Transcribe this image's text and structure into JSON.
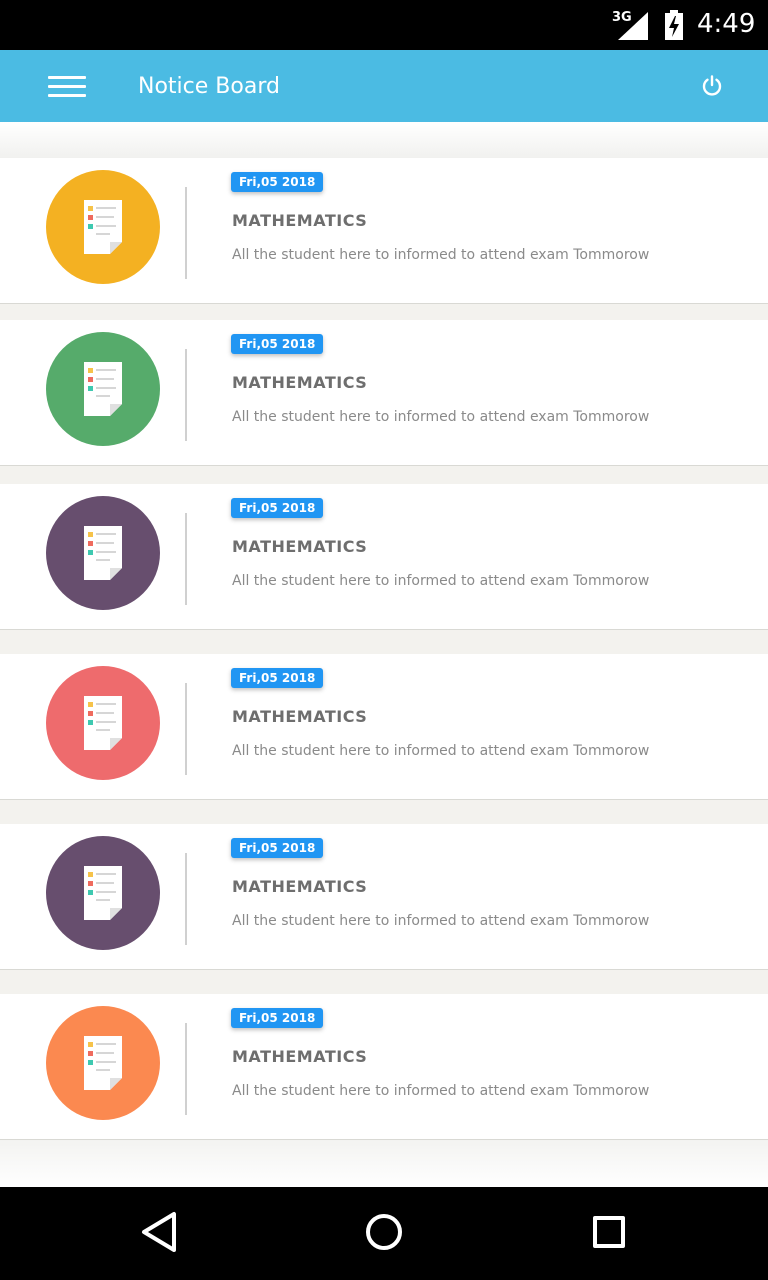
{
  "status_bar": {
    "network": "3G",
    "time": "4:49"
  },
  "app_bar": {
    "title": "Notice Board"
  },
  "notices": [
    {
      "date": "Fri,05 2018",
      "subject": "MATHEMATICS",
      "message": "All the student here to informed to attend exam Tommorow",
      "color": "#f4b122"
    },
    {
      "date": "Fri,05 2018",
      "subject": "MATHEMATICS",
      "message": "All the student here to informed to attend exam Tommorow",
      "color": "#56ab6b"
    },
    {
      "date": "Fri,05 2018",
      "subject": "MATHEMATICS",
      "message": "All the student here to informed to attend exam Tommorow",
      "color": "#674e6e"
    },
    {
      "date": "Fri,05 2018",
      "subject": "MATHEMATICS",
      "message": "All the student here to informed to attend exam Tommorow",
      "color": "#ee6b6d"
    },
    {
      "date": "Fri,05 2018",
      "subject": "MATHEMATICS",
      "message": "All the student here to informed to attend exam Tommorow",
      "color": "#674e6e"
    },
    {
      "date": "Fri,05 2018",
      "subject": "MATHEMATICS",
      "message": "All the student here to informed to attend exam Tommorow",
      "color": "#fb8950"
    }
  ],
  "colors": {
    "app_bar": "#4bbbe3",
    "badge": "#2196f3"
  }
}
